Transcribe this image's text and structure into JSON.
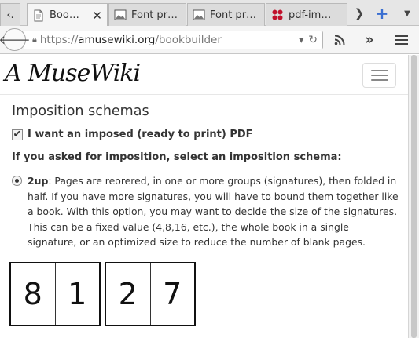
{
  "browser": {
    "tab_overflow_label": "‹.",
    "tabs": [
      {
        "title": "Boo…",
        "favicon": "document-icon",
        "active": true
      },
      {
        "title": "Font pr…",
        "favicon": "image-icon",
        "active": false
      },
      {
        "title": "Font pr…",
        "favicon": "image-icon",
        "active": false
      },
      {
        "title": "pdf-im…",
        "favicon": "red-dots-icon",
        "active": false
      }
    ],
    "new_tab_symbol": "+",
    "url_scheme": "https://",
    "url_host": "amusewiki.org",
    "url_path": "/bookbuilder"
  },
  "site": {
    "logo_text": "A MuseWiki"
  },
  "form": {
    "section_title": "Imposition schemas",
    "impose_checkbox_label": "I want an imposed (ready to print) PDF",
    "impose_checked": true,
    "imposition_prompt": "If you asked for imposition, select an imposition schema:",
    "schema_name": "2up",
    "schema_description": ": Pages are reorered, in one or more groups (signatures), then folded in half. If you have more signatures, you will have to bound them together like a book. With this option, you may want to decide the size of the signatures. This can be a fixed value (4,8,16, etc.), the whole book in a single signature, or an optimized size to reduce the number of blank pages.",
    "schema_selected": true
  },
  "diagram": {
    "sheets": [
      {
        "left": "8",
        "right": "1"
      },
      {
        "left": "2",
        "right": "7"
      }
    ]
  },
  "colors": {
    "tab_bg": "#dcdcdc",
    "active_tab_bg": "#f5f5f5",
    "chrome_bg": "#e6e6e6",
    "text": "#333333"
  }
}
